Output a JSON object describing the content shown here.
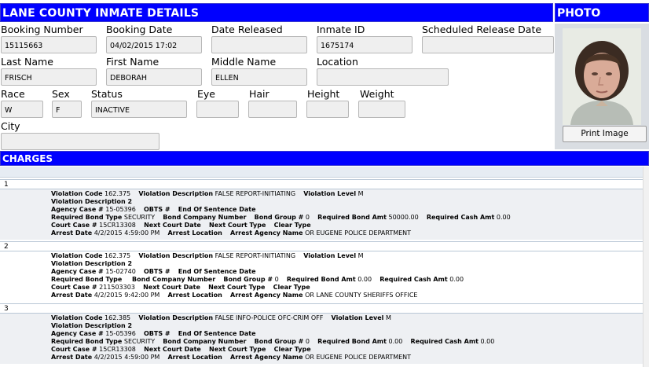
{
  "header": {
    "details_title": "LANE COUNTY INMATE DETAILS",
    "photo_title": "PHOTO",
    "charges_title": "CHARGES"
  },
  "fields": {
    "booking_number": {
      "label": "Booking Number",
      "value": "15115663"
    },
    "booking_date": {
      "label": "Booking Date",
      "value": "04/02/2015 17:02"
    },
    "date_released": {
      "label": "Date Released",
      "value": ""
    },
    "inmate_id": {
      "label": "Inmate ID",
      "value": "1675174"
    },
    "scheduled_release_date": {
      "label": "Scheduled Release Date",
      "value": ""
    },
    "last_name": {
      "label": "Last Name",
      "value": "FRISCH"
    },
    "first_name": {
      "label": "First Name",
      "value": "DEBORAH"
    },
    "middle_name": {
      "label": "Middle Name",
      "value": "ELLEN"
    },
    "location": {
      "label": "Location",
      "value": ""
    },
    "race": {
      "label": "Race",
      "value": "W"
    },
    "sex": {
      "label": "Sex",
      "value": "F"
    },
    "status": {
      "label": "Status",
      "value": "INACTIVE"
    },
    "eye": {
      "label": "Eye",
      "value": ""
    },
    "hair": {
      "label": "Hair",
      "value": ""
    },
    "height": {
      "label": "Height",
      "value": ""
    },
    "weight": {
      "label": "Weight",
      "value": ""
    },
    "city": {
      "label": "City",
      "value": ""
    }
  },
  "photo": {
    "print_label": "Print Image"
  },
  "charge_labels": {
    "violation_code": "Violation Code",
    "violation_description": "Violation Description",
    "violation_level": "Violation Level",
    "violation_description_2": "Violation Description 2",
    "agency_case": "Agency Case #",
    "obts": "OBTS #",
    "end_of_sentence": "End Of Sentence Date",
    "required_bond_type": "Required Bond Type",
    "bond_company_number": "Bond Company Number",
    "bond_group": "Bond Group #",
    "required_bond_amt": "Required Bond Amt",
    "required_cash_amt": "Required Cash Amt",
    "court_case": "Court Case #",
    "next_court_date": "Next Court Date",
    "next_court_type": "Next Court Type",
    "clear_type": "Clear Type",
    "arrest_date": "Arrest Date",
    "arrest_location": "Arrest Location",
    "arrest_agency_name": "Arrest Agency Name"
  },
  "charges": [
    {
      "number": "1",
      "violation_code": "162.375",
      "violation_description": "FALSE REPORT-INITIATING",
      "violation_level": "M",
      "agency_case": "15-05396",
      "required_bond_type": "SECURITY",
      "bond_group": "0",
      "required_bond_amt": "50000.00",
      "required_cash_amt": "0.00",
      "court_case": "15CR13308",
      "arrest_date": "4/2/2015 4:59:00 PM",
      "arrest_agency_name": "OR EUGENE POLICE DEPARTMENT"
    },
    {
      "number": "2",
      "violation_code": "162.375",
      "violation_description": "FALSE REPORT-INITIATING",
      "violation_level": "M",
      "agency_case": "15-02740",
      "required_bond_type": "",
      "bond_group": "0",
      "required_bond_amt": "0.00",
      "required_cash_amt": "0.00",
      "court_case": "211503303",
      "arrest_date": "4/2/2015 9:42:00 PM",
      "arrest_agency_name": "OR LANE COUNTY SHERIFFS OFFICE"
    },
    {
      "number": "3",
      "violation_code": "162.385",
      "violation_description": "FALSE INFO-POLICE OFC-CRIM OFF",
      "violation_level": "M",
      "agency_case": "15-05396",
      "required_bond_type": "SECURITY",
      "bond_group": "0",
      "required_bond_amt": "0.00",
      "required_cash_amt": "0.00",
      "court_case": "15CR13308",
      "arrest_date": "4/2/2015 4:59:00 PM",
      "arrest_agency_name": "OR EUGENE POLICE DEPARTMENT"
    }
  ]
}
